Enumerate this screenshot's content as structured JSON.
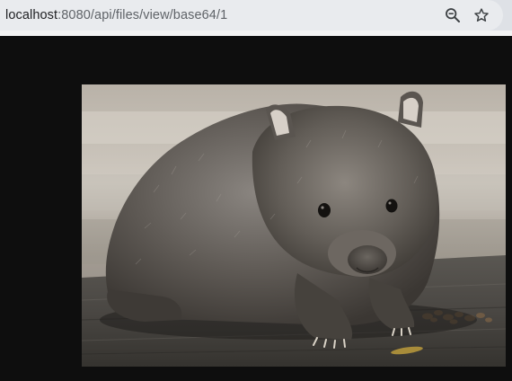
{
  "browser": {
    "url_host": "localhost",
    "url_path": ":8080/api/files/view/base64/1",
    "icons": {
      "zoom": "zoom-out-magnifier-icon",
      "bookmark": "bookmark-star-icon"
    }
  },
  "content": {
    "image_subject": "wombat",
    "background_color": "#0e0e0e"
  },
  "colors": {
    "toolbar": "#dee1e6",
    "omnibox": "#e9ebee",
    "url_host": "#202124",
    "url_path": "#5f6368"
  }
}
